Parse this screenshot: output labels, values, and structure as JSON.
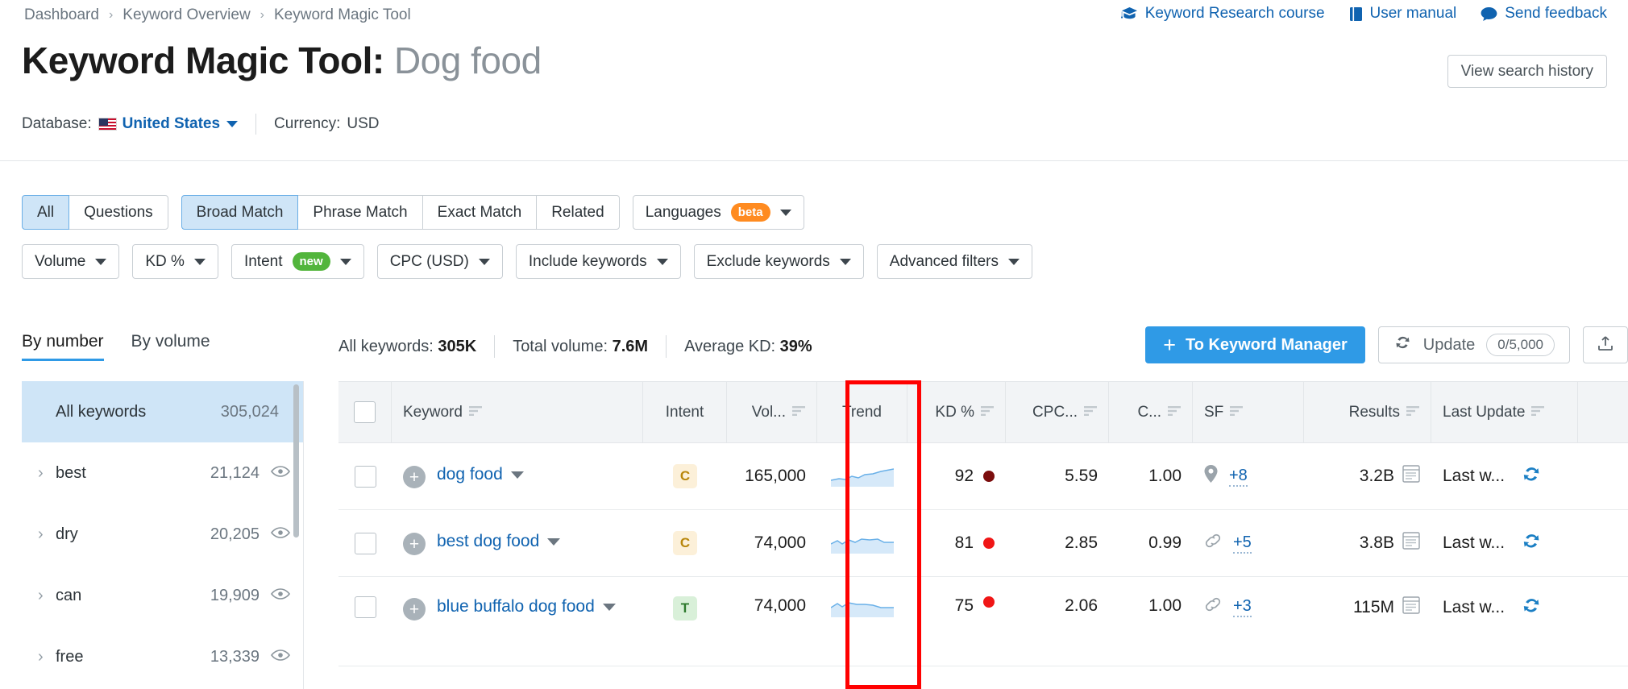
{
  "breadcrumb": {
    "items": [
      "Dashboard",
      "Keyword Overview",
      "Keyword Magic Tool"
    ],
    "separator": "›"
  },
  "header_links": [
    {
      "label": "Keyword Research course",
      "icon": "graduation-cap-icon"
    },
    {
      "label": "User manual",
      "icon": "book-icon"
    },
    {
      "label": "Send feedback",
      "icon": "speech-bubble-icon"
    }
  ],
  "title": {
    "main": "Keyword Magic Tool:",
    "query": "Dog food"
  },
  "view_history_label": "View search history",
  "database": {
    "label": "Database:",
    "country": "United States",
    "flag": "us-flag-icon",
    "currency_label": "Currency:",
    "currency_value": "USD"
  },
  "match_tabs": [
    {
      "label": "All",
      "active": true
    },
    {
      "label": "Questions",
      "active": false
    }
  ],
  "match_types": [
    {
      "label": "Broad Match",
      "active": true
    },
    {
      "label": "Phrase Match",
      "active": false
    },
    {
      "label": "Exact Match",
      "active": false
    },
    {
      "label": "Related",
      "active": false
    }
  ],
  "languages_filter": {
    "label": "Languages",
    "badge": "beta"
  },
  "filters": [
    {
      "label": "Volume",
      "badge": null
    },
    {
      "label": "KD %",
      "badge": null
    },
    {
      "label": "Intent",
      "badge": "new"
    },
    {
      "label": "CPC (USD)",
      "badge": null
    },
    {
      "label": "Include keywords",
      "badge": null
    },
    {
      "label": "Exclude keywords",
      "badge": null
    },
    {
      "label": "Advanced filters",
      "badge": null
    }
  ],
  "group_tabs": [
    {
      "label": "By number",
      "active": true
    },
    {
      "label": "By volume",
      "active": false
    }
  ],
  "summary": [
    {
      "label": "All keywords:",
      "value": "305K"
    },
    {
      "label": "Total volume:",
      "value": "7.6M"
    },
    {
      "label": "Average KD:",
      "value": "39%"
    }
  ],
  "actions": {
    "keyword_manager_label": "To Keyword Manager",
    "plus": "+",
    "update_label": "Update",
    "update_counter": "0/5,000",
    "export_icon": "export-icon"
  },
  "sidebar": {
    "all_keywords": {
      "label": "All keywords",
      "count": "305,024"
    },
    "groups": [
      {
        "label": "best",
        "count": "21,124"
      },
      {
        "label": "dry",
        "count": "20,205"
      },
      {
        "label": "can",
        "count": "19,909"
      },
      {
        "label": "free",
        "count": "13,339"
      }
    ]
  },
  "table": {
    "columns": [
      {
        "key": "checkbox",
        "label": "",
        "sortable": false
      },
      {
        "key": "keyword",
        "label": "Keyword",
        "sortable": true
      },
      {
        "key": "intent",
        "label": "Intent",
        "sortable": false
      },
      {
        "key": "volume",
        "label": "Vol...",
        "sortable": true
      },
      {
        "key": "trend",
        "label": "Trend",
        "sortable": false
      },
      {
        "key": "kd",
        "label": "KD %",
        "sortable": true
      },
      {
        "key": "cpc",
        "label": "CPC...",
        "sortable": true
      },
      {
        "key": "com",
        "label": "C...",
        "sortable": true
      },
      {
        "key": "sf",
        "label": "SF",
        "sortable": true
      },
      {
        "key": "results",
        "label": "Results",
        "sortable": true
      },
      {
        "key": "last_update",
        "label": "Last Update",
        "sortable": true
      }
    ],
    "rows": [
      {
        "keyword": "dog food",
        "intent": "C",
        "volume": "165,000",
        "kd": "92",
        "kd_color": "#7b0d0d",
        "cpc": "5.59",
        "com": "1.00",
        "sf_icon": "map-pin-icon",
        "sf": "+8",
        "results": "3.2B",
        "last_update": "Last w..."
      },
      {
        "keyword": "best dog food",
        "intent": "C",
        "volume": "74,000",
        "kd": "81",
        "kd_color": "#f01616",
        "cpc": "2.85",
        "com": "0.99",
        "sf_icon": "link-icon",
        "sf": "+5",
        "results": "3.8B",
        "last_update": "Last w..."
      },
      {
        "keyword": "blue buffalo dog food",
        "intent": "T",
        "volume": "74,000",
        "kd": "75",
        "kd_color": "#f01616",
        "cpc": "2.06",
        "com": "1.00",
        "sf_icon": "link-icon",
        "sf": "+3",
        "results": "115M",
        "last_update": "Last w..."
      }
    ]
  },
  "colors": {
    "accent_blue": "#2f9ae6",
    "link_blue": "#1063b0",
    "selected_bg": "#cfe5f7",
    "badge_beta": "#ff8b20",
    "badge_new": "#52b53c",
    "annotation_red": "#ff0000",
    "intent_c_bg": "#fcf0d9",
    "intent_c_fg": "#b8860b",
    "intent_t_bg": "#d9f0d9",
    "intent_t_fg": "#2d7a2d"
  }
}
